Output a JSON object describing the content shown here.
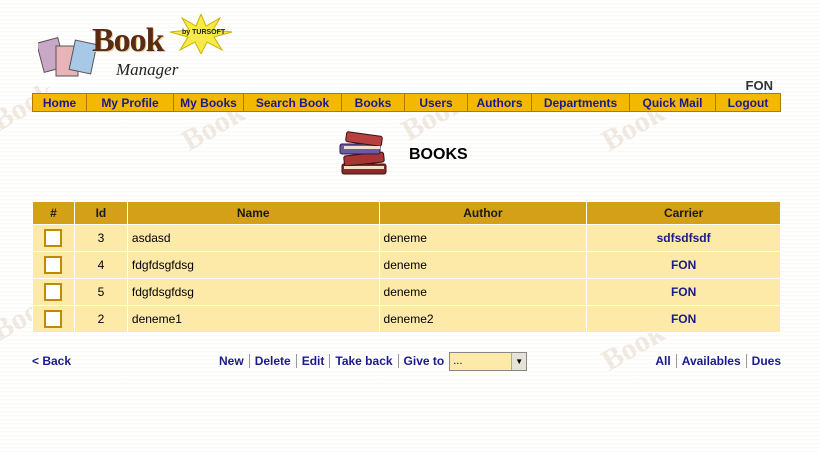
{
  "logo": {
    "title": "Book",
    "subtitle": "Manager",
    "by": "by TURSOFT"
  },
  "user": {
    "name": "FON"
  },
  "nav": [
    "Home",
    "My Profile",
    "My Books",
    "Search Book",
    "Books",
    "Users",
    "Authors",
    "Departments",
    "Quick Mail",
    "Logout"
  ],
  "page": {
    "title": "BOOKS",
    "icon": "books-icon"
  },
  "table": {
    "headers": [
      "#",
      "Id",
      "Name",
      "Author",
      "Carrier"
    ],
    "rows": [
      {
        "id": "3",
        "name": "asdasd",
        "author": "deneme",
        "carrier": "sdfsdfsdf"
      },
      {
        "id": "4",
        "name": "fdgfdsgfdsg",
        "author": "deneme",
        "carrier": "FON"
      },
      {
        "id": "5",
        "name": "fdgfdsgfdsg",
        "author": "deneme",
        "carrier": "FON"
      },
      {
        "id": "2",
        "name": "deneme1",
        "author": "deneme2",
        "carrier": "FON"
      }
    ]
  },
  "footer": {
    "back": "< Back",
    "actions": [
      "New",
      "Delete",
      "Edit",
      "Take back"
    ],
    "give_to_label": "Give to",
    "give_to_value": "...",
    "filters": [
      "All",
      "Availables",
      "Dues"
    ]
  },
  "colors": {
    "nav_bg": "#f5b800",
    "header_bg": "#d4a017",
    "row_bg": "#fde9a8",
    "link": "#1a1a8c"
  }
}
